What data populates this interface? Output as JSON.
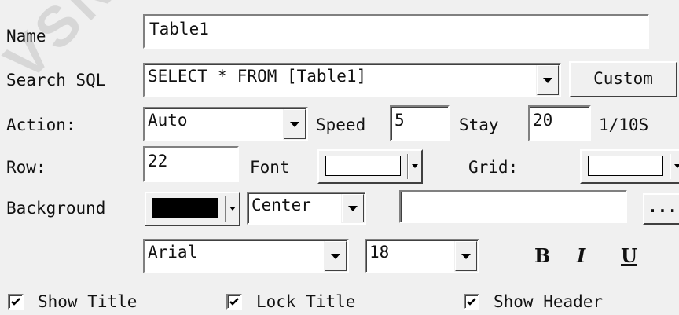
{
  "watermark": "VSN",
  "name": {
    "label": "Name",
    "value": "Table1"
  },
  "sql": {
    "label": "Search SQL",
    "value": "SELECT * FROM [Table1]",
    "custom_label": "Custom"
  },
  "action": {
    "label": "Action:",
    "value": "Auto",
    "speed_label": "Speed",
    "speed_value": "5",
    "stay_label": "Stay",
    "stay_value": "20",
    "stay_unit": "1/10S"
  },
  "row": {
    "label": "Row:",
    "value": "22",
    "font_label": "Font",
    "font_color": "#ffffff",
    "grid_label": "Grid:",
    "grid_color": "#ffffff"
  },
  "background": {
    "label": "Background",
    "color": "#000000",
    "align_value": "Center",
    "image_path": "",
    "browse_label": "..."
  },
  "font": {
    "family": "Arial",
    "size": "18",
    "bold": "B",
    "italic": "I",
    "underline": "U"
  },
  "options": [
    {
      "label": "Show Title",
      "checked": true
    },
    {
      "label": "Lock Title",
      "checked": true
    },
    {
      "label": "Show Header",
      "checked": true
    }
  ]
}
